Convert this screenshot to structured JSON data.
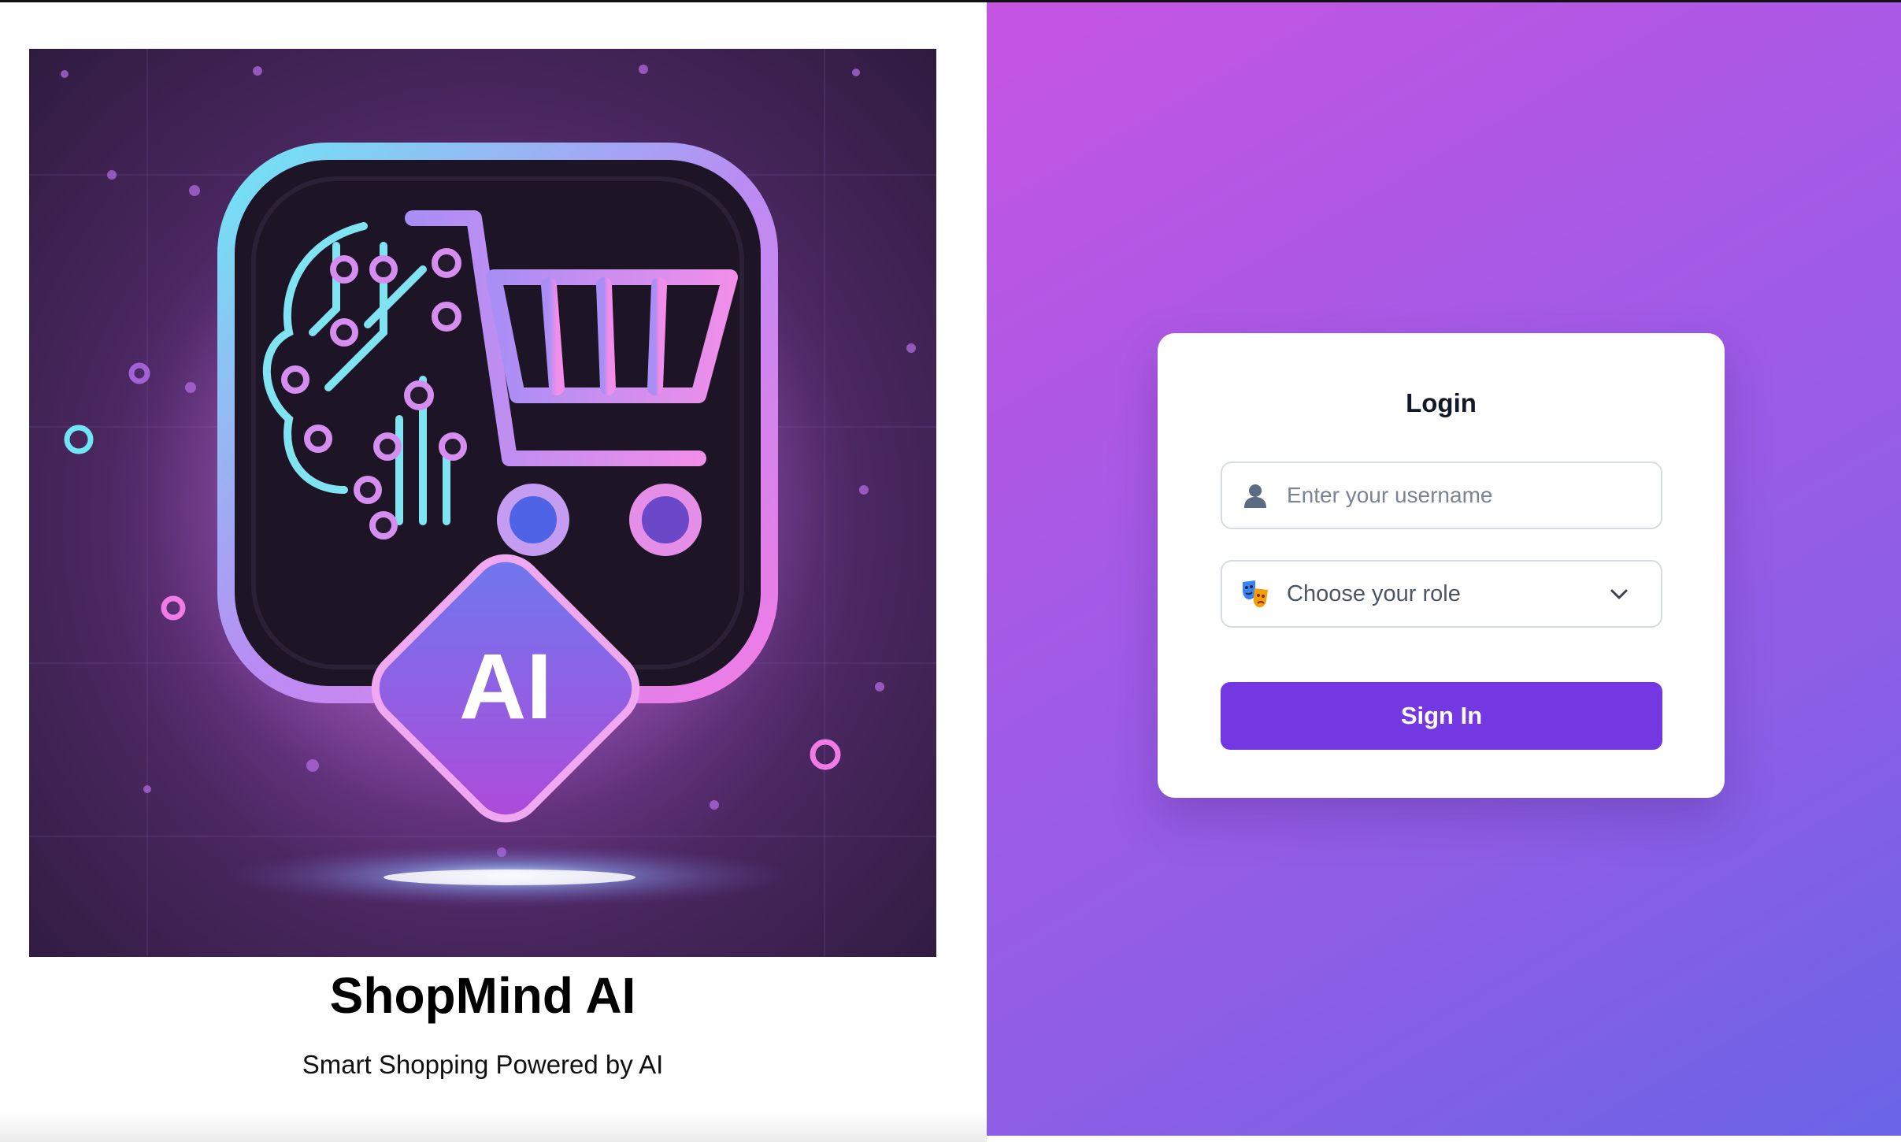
{
  "brand": {
    "name": "ShopMind AI",
    "tagline": "Smart Shopping Powered by AI",
    "logo_badge_text": "AI"
  },
  "login": {
    "title": "Login",
    "username_placeholder": "Enter your username",
    "username_icon": "user-silhouette-icon",
    "role_placeholder": "Choose your role",
    "role_icon": "theater-masks-icon",
    "submit_label": "Sign In"
  },
  "colors": {
    "accent": "#7438e2",
    "gradient_start": "#c654e2",
    "gradient_end": "#6a64e6",
    "neon_cyan": "#5fe0f0",
    "neon_pink": "#e07ae8"
  }
}
